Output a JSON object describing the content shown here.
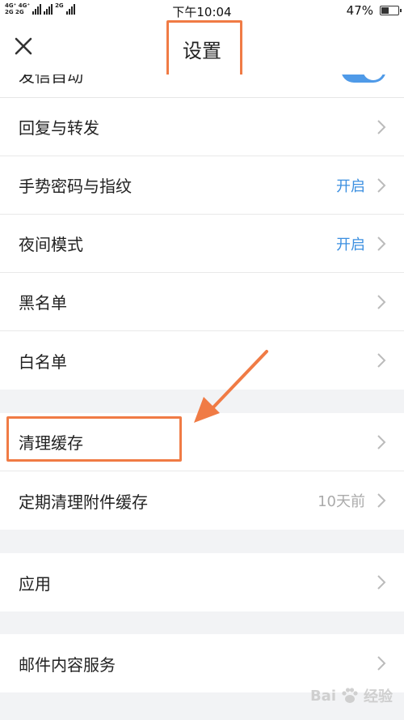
{
  "status_bar": {
    "network_top": "4G⁺ 4G⁺",
    "network_bottom": "2G 2G",
    "network_extra": "2G",
    "time": "下午10:04",
    "battery": "47%",
    "battery_level": 0.47
  },
  "nav": {
    "title": "设置",
    "close_icon": "close-icon"
  },
  "partial_row": {
    "label": "发信自动",
    "toggle_on": true
  },
  "groups": [
    {
      "items": [
        {
          "label": "回复与转发",
          "value": ""
        },
        {
          "label": "手势密码与指纹",
          "value": "开启"
        },
        {
          "label": "夜间模式",
          "value": "开启"
        },
        {
          "label": "黑名单",
          "value": ""
        },
        {
          "label": "白名单",
          "value": ""
        }
      ]
    },
    {
      "items": [
        {
          "label": "清理缓存",
          "value": ""
        },
        {
          "label": "定期清理附件缓存",
          "value": "10天前"
        }
      ]
    },
    {
      "items": [
        {
          "label": "应用",
          "value": ""
        }
      ]
    },
    {
      "items": [
        {
          "label": "邮件内容服务",
          "value": ""
        }
      ]
    }
  ],
  "watermark": {
    "brand": "Bai",
    "suffix": "经验"
  },
  "colors": {
    "accent_blue": "#3b8fe0",
    "annotation_orange": "#f07b45",
    "toggle_blue": "#4f9ae8"
  }
}
